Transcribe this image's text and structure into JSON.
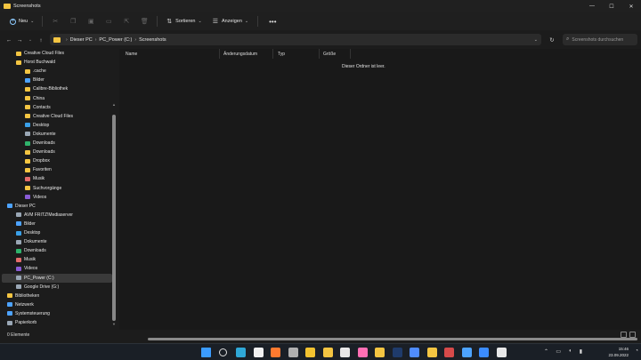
{
  "window": {
    "title": "Screenshots"
  },
  "window_controls": {
    "minimize": "—",
    "maximize": "☐",
    "close": "✕"
  },
  "toolbar": {
    "new_label": "Neu",
    "sort_label": "Sortieren",
    "view_label": "Anzeigen",
    "more_label": "•••"
  },
  "address": {
    "crumbs": [
      "Dieser PC",
      "PC_Power (C:)",
      "Screenshots"
    ],
    "search_placeholder": "Screenshots durchsuchen"
  },
  "sidebar": {
    "items": [
      {
        "label": "Creative Cloud Files",
        "icon": "cloud-folder-icon",
        "color": "#f4c542"
      },
      {
        "label": "Horst Buchwald",
        "icon": "user-folder-icon",
        "color": "#f4c542"
      },
      {
        "label": ".cache",
        "icon": "folder-icon",
        "color": "#f4c542"
      },
      {
        "label": "Bilder",
        "icon": "pictures-folder-icon",
        "color": "#4da3ff"
      },
      {
        "label": "Calibre-Bibliothek",
        "icon": "folder-icon",
        "color": "#f4c542"
      },
      {
        "label": "China",
        "icon": "folder-icon",
        "color": "#f4c542"
      },
      {
        "label": "Contacts",
        "icon": "contacts-folder-icon",
        "color": "#f4c542"
      },
      {
        "label": "Creative Cloud Files",
        "icon": "cloud-folder-icon",
        "color": "#f4c542"
      },
      {
        "label": "Desktop",
        "icon": "desktop-folder-icon",
        "color": "#3aa0e8"
      },
      {
        "label": "Dokumente",
        "icon": "documents-folder-icon",
        "color": "#9aa7b5"
      },
      {
        "label": "Downloads",
        "icon": "downloads-folder-icon",
        "color": "#2fb26b"
      },
      {
        "label": "Downloads",
        "icon": "downloads-folder-icon",
        "color": "#f4c542"
      },
      {
        "label": "Dropbox",
        "icon": "folder-icon",
        "color": "#f4c542"
      },
      {
        "label": "Favoriten",
        "icon": "favorites-folder-icon",
        "color": "#f4c542"
      },
      {
        "label": "Musik",
        "icon": "music-folder-icon",
        "color": "#e56b6b"
      },
      {
        "label": "Suchvorgänge",
        "icon": "search-folder-icon",
        "color": "#f4c542"
      },
      {
        "label": "Videos",
        "icon": "videos-folder-icon",
        "color": "#8a5cd6"
      },
      {
        "label": "Dieser PC",
        "icon": "pc-icon",
        "color": "#4da3ff"
      },
      {
        "label": "AVM FRITZ!Mediaserver",
        "icon": "media-server-icon",
        "color": "#9aa7b5"
      },
      {
        "label": "Bilder",
        "icon": "pictures-folder-icon",
        "color": "#4da3ff"
      },
      {
        "label": "Desktop",
        "icon": "desktop-folder-icon",
        "color": "#3aa0e8"
      },
      {
        "label": "Dokumente",
        "icon": "documents-folder-icon",
        "color": "#9aa7b5"
      },
      {
        "label": "Downloads",
        "icon": "downloads-folder-icon",
        "color": "#2fb26b"
      },
      {
        "label": "Musik",
        "icon": "music-folder-icon",
        "color": "#e56b6b"
      },
      {
        "label": "Videos",
        "icon": "videos-folder-icon",
        "color": "#8a5cd6"
      },
      {
        "label": "PC_Power (C:)",
        "icon": "drive-icon",
        "color": "#9aa7b5",
        "selected": true
      },
      {
        "label": "Google Drive (G:)",
        "icon": "drive-icon",
        "color": "#9aa7b5"
      },
      {
        "label": "Bibliotheken",
        "icon": "libraries-folder-icon",
        "color": "#f4c542"
      },
      {
        "label": "Netzwerk",
        "icon": "network-icon",
        "color": "#4da3ff"
      },
      {
        "label": "Systemsteuerung",
        "icon": "control-panel-icon",
        "color": "#4da3ff"
      },
      {
        "label": "Papierkorb",
        "icon": "recycle-bin-icon",
        "color": "#9aa7b5"
      }
    ]
  },
  "content": {
    "columns": [
      "Name",
      "Änderungsdatum",
      "Typ",
      "Größe"
    ],
    "empty_message": "Dieser Ordner ist leer."
  },
  "status": {
    "items_count": "0 Elemente"
  },
  "taskbar": {
    "time": "15:46",
    "date": "23.09.2022",
    "apps": [
      {
        "icon": "windows-start-icon",
        "color": "#3b9cff"
      },
      {
        "icon": "search-icon",
        "color": "#dddddd"
      },
      {
        "icon": "edge-icon",
        "color": "#2fa8d8"
      },
      {
        "icon": "globe-icon",
        "color": "#f0f0f0"
      },
      {
        "icon": "firefox-icon",
        "color": "#ff7a2f"
      },
      {
        "icon": "app-icon",
        "color": "#b0b0b0"
      },
      {
        "icon": "chrome-icon",
        "color": "#f2c230"
      },
      {
        "icon": "explorer-icon",
        "color": "#f4c542"
      },
      {
        "icon": "photos-icon",
        "color": "#e8e8e8"
      },
      {
        "icon": "paint-icon",
        "color": "#ff6fb5"
      },
      {
        "icon": "drive-icon",
        "color": "#f4c542"
      },
      {
        "icon": "photoshop-icon",
        "color": "#1f3b6b"
      },
      {
        "icon": "app-icon",
        "color": "#4f8cff"
      },
      {
        "icon": "app-icon",
        "color": "#f4c542"
      },
      {
        "icon": "app-icon",
        "color": "#d64a4a"
      },
      {
        "icon": "app-icon",
        "color": "#4da3ff"
      },
      {
        "icon": "todo-icon",
        "color": "#3b8cff"
      },
      {
        "icon": "app-icon",
        "color": "#e8e8e8"
      }
    ]
  }
}
